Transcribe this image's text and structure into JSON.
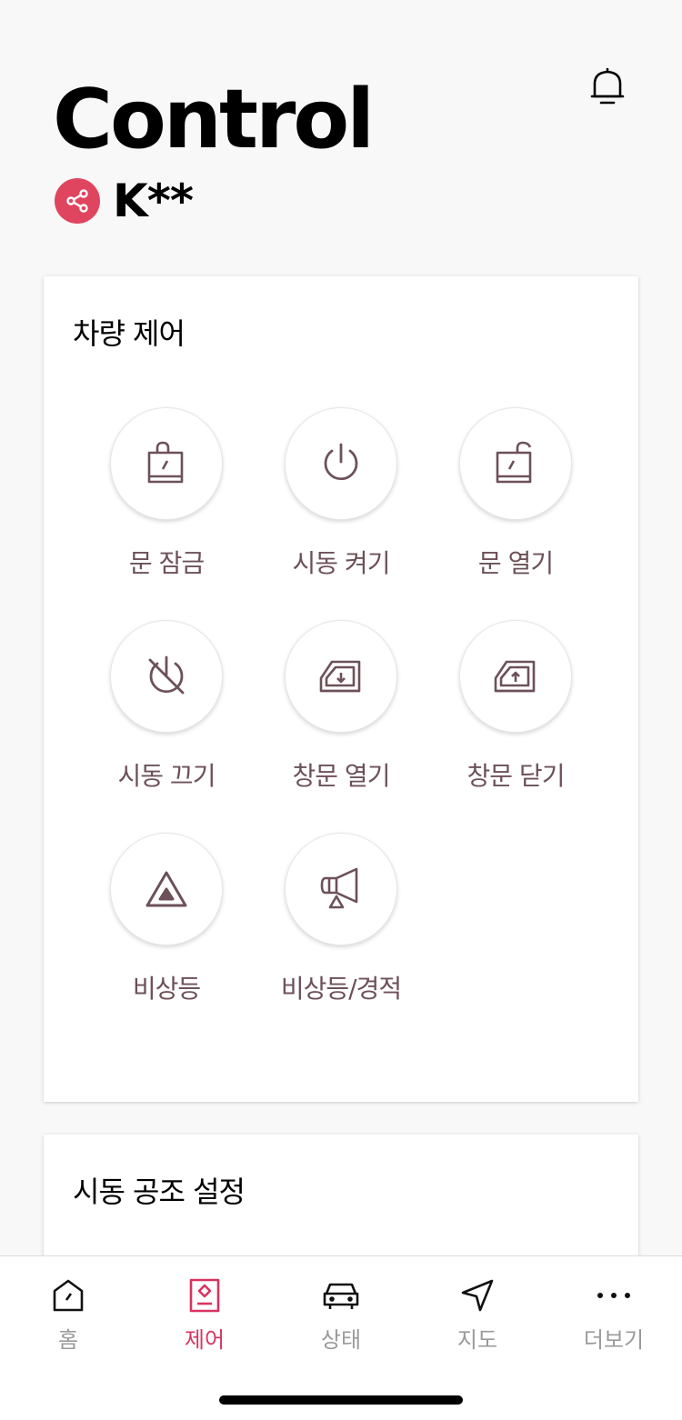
{
  "header": {
    "title": "Control",
    "vehicle_name": "K**",
    "icons": {
      "bell": "bell-icon",
      "share": "share-icon"
    },
    "share_color": "#e0455f"
  },
  "vehicle_control": {
    "title": "차량 제어",
    "buttons": [
      {
        "label": "문 잠금",
        "icon": "door-lock-icon"
      },
      {
        "label": "시동 켜기",
        "icon": "power-on-icon"
      },
      {
        "label": "문 열기",
        "icon": "door-unlock-icon"
      },
      {
        "label": "시동 끄기",
        "icon": "power-off-icon"
      },
      {
        "label": "창문 열기",
        "icon": "window-open-icon"
      },
      {
        "label": "창문 닫기",
        "icon": "window-close-icon"
      },
      {
        "label": "비상등",
        "icon": "hazard-light-icon"
      },
      {
        "label": "비상등/경적",
        "icon": "hazard-horn-icon"
      }
    ],
    "icon_color": "#6d5158"
  },
  "climate": {
    "title": "시동 공조 설정"
  },
  "tabbar": {
    "active": "제어",
    "accent": "#d8345f",
    "items": [
      {
        "label": "홈",
        "icon": "home-icon"
      },
      {
        "label": "제어",
        "icon": "control-icon"
      },
      {
        "label": "상태",
        "icon": "car-status-icon"
      },
      {
        "label": "지도",
        "icon": "navigation-icon"
      },
      {
        "label": "더보기",
        "icon": "more-icon"
      }
    ]
  }
}
